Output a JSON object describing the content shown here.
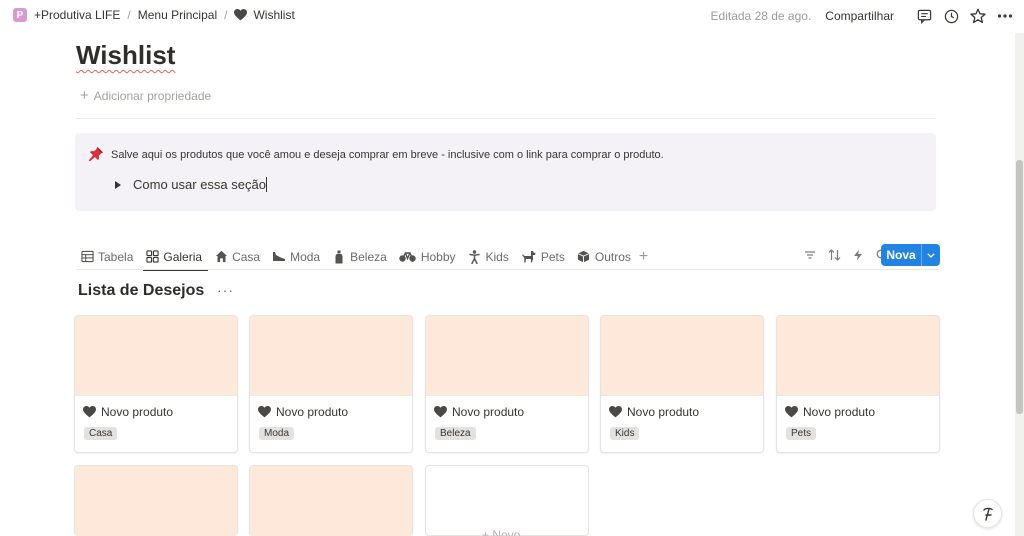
{
  "breadcrumb": {
    "workspace_logo": "P",
    "items": [
      "+Produtiva LIFE",
      "Menu Principal",
      "Wishlist"
    ],
    "separator": "/"
  },
  "topbar": {
    "edited": "Editada 28 de ago.",
    "share": "Compartilhar",
    "icons": [
      "comment-icon",
      "clock-icon",
      "star-icon",
      "more-icon"
    ]
  },
  "page": {
    "title": "Wishlist",
    "add_property": "Adicionar propriedade",
    "icon": "heart-icon"
  },
  "callout": {
    "icon": "pushpin-icon",
    "text": "Salve aqui os produtos que você amou e deseja comprar em breve - inclusive com o link para comprar o produto.",
    "toggle_label": "Como usar essa seção"
  },
  "views": {
    "tabs": [
      {
        "label": "Tabela",
        "icon": "table-icon",
        "active": false
      },
      {
        "label": "Galeria",
        "icon": "gallery-icon",
        "active": true
      },
      {
        "label": "Casa",
        "icon": "house-icon",
        "active": false
      },
      {
        "label": "Moda",
        "icon": "shoe-icon",
        "active": false
      },
      {
        "label": "Beleza",
        "icon": "bottle-icon",
        "active": false
      },
      {
        "label": "Hobby",
        "icon": "bike-icon",
        "active": false
      },
      {
        "label": "Kids",
        "icon": "child-icon",
        "active": false
      },
      {
        "label": "Pets",
        "icon": "dog-icon",
        "active": false
      },
      {
        "label": "Outros",
        "icon": "box-icon",
        "active": false
      }
    ],
    "tools": [
      "filter-icon",
      "sort-icon",
      "automation-icon",
      "search-icon",
      "expand-icon",
      "more-icon"
    ],
    "new_button": "Nova"
  },
  "list": {
    "title": "Lista de Desejos",
    "more": "···",
    "cards": [
      {
        "name": "Novo produto",
        "tag": "Casa"
      },
      {
        "name": "Novo produto",
        "tag": "Moda"
      },
      {
        "name": "Novo produto",
        "tag": "Beleza"
      },
      {
        "name": "Novo produto",
        "tag": "Kids"
      },
      {
        "name": "Novo produto",
        "tag": "Pets"
      }
    ],
    "new_card": "+ Novo"
  },
  "colors": {
    "accent": "#2383e2",
    "cover": "#fde8d9",
    "callout_bg": "#f4f2f6"
  }
}
